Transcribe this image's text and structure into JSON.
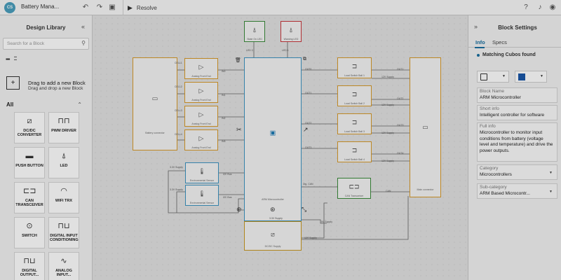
{
  "app": {
    "logo": "CS",
    "title": "Battery Mana..."
  },
  "toolbar": {
    "resolve_label": "Resolve"
  },
  "left_panel": {
    "title": "Design Library",
    "search_placeholder": "Search for a Block",
    "drag_title": "Drag to add a new Block",
    "drag_subtitle": "Drag and drop a new Block",
    "section_label": "All",
    "items": [
      {
        "label": "DC/DC CONVERTER",
        "icon": "dc-dc-icon"
      },
      {
        "label": "PWM DRIVER",
        "icon": "pwm-icon"
      },
      {
        "label": "PUSH BUTTON",
        "icon": "push-button-icon"
      },
      {
        "label": "LED",
        "icon": "led-icon"
      },
      {
        "label": "CAN TRANSCEIVER",
        "icon": "can-icon"
      },
      {
        "label": "WIFI TRX",
        "icon": "wifi-icon"
      },
      {
        "label": "SWITCH",
        "icon": "switch-icon"
      },
      {
        "label": "DIGITAL INPUT CONDITIONING",
        "icon": "digital-input-icon"
      },
      {
        "label": "DIGITAL OUTPUT...",
        "icon": "digital-output-icon"
      },
      {
        "label": "ANALOG INPUT...",
        "icon": "analog-input-icon"
      }
    ]
  },
  "canvas": {
    "battery": "Battery connector",
    "afe": [
      "Analog Front End",
      "Analog Front End",
      "Analog Front End",
      "Analog Front End"
    ],
    "cells": [
      "CELL1",
      "CELL2",
      "CELL3",
      "CELL4"
    ],
    "ains": [
      "IN0",
      "IN1",
      "IN2",
      "IN3"
    ],
    "leds": [
      "State On LED",
      "Warning LED"
    ],
    "led_pins": [
      "LED 0",
      "LED 1"
    ],
    "mcu": "ARM Microcontroller",
    "outs": [
      "OUT0",
      "OUT1",
      "OUT2",
      "OUT3"
    ],
    "load_switches": [
      "Load Switch Ball 1",
      "Load Switch Ball 2",
      "Load Switch Ball 3",
      "Load Switch Ball 4"
    ],
    "load_out": [
      "OUT1",
      "OUT2",
      "OUT3",
      "OUT4"
    ],
    "supply_12v": "12V Supply",
    "main_connector": "Main connector",
    "env_sensors": [
      "Environmental Sensor",
      "Environmental Sensor"
    ],
    "supply_33v": "3.3V Supply",
    "i2c": "I2C Bus",
    "dig_can": "Dig. CAN",
    "can": "CAN",
    "can_xcvr": "CAN Transceiver",
    "dcdc": "DC/DC Supply",
    "supply_5v": "5V Supply"
  },
  "right_panel": {
    "title": "Block Settings",
    "tabs": [
      "Info",
      "Specs"
    ],
    "match_text": "Matching Cubos found",
    "accent_color": "#1a57a8",
    "block_name_label": "Block Name",
    "block_name": "ARM Microcontroller",
    "short_info_label": "Short info",
    "short_info": "Intelligent controller for software",
    "full_info_label": "Full info",
    "full_info": "Microcontroller to monitor input conditions from battery (voltage level and temperature) and drive the power outputs.",
    "category_label": "Category",
    "category": "Microcontrollers",
    "subcategory_label": "Sub-category",
    "subcategory": "ARM Based Microcontr..."
  }
}
